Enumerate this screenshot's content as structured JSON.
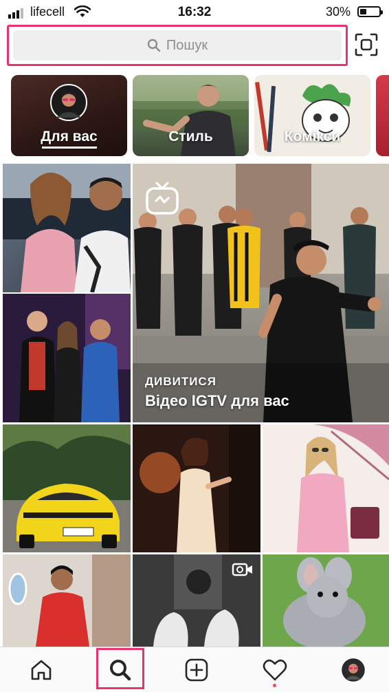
{
  "status_bar": {
    "carrier": "lifecell",
    "time": "16:32",
    "battery": "30%"
  },
  "search": {
    "placeholder": "Пошук"
  },
  "topics": [
    {
      "label": "Для вас",
      "selected": true
    },
    {
      "label": "Стиль",
      "selected": false
    },
    {
      "label": "Комікси",
      "selected": false
    }
  ],
  "igtv": {
    "subtitle": "ДИВИТИСЯ",
    "title": "Відео IGTV для вас"
  },
  "grid_posts": [
    {
      "name": "post-selfie-couple"
    },
    {
      "name": "post-event-trio"
    },
    {
      "name": "post-igtv-group"
    },
    {
      "name": "post-yellow-car"
    },
    {
      "name": "post-woman-doorway"
    },
    {
      "name": "post-woman-umbrella"
    },
    {
      "name": "post-man-jet"
    },
    {
      "name": "post-sneakers-video"
    },
    {
      "name": "post-chinchilla"
    }
  ],
  "tab_bar": {
    "items": [
      "home",
      "search",
      "new-post",
      "activity",
      "profile"
    ],
    "active": "search"
  },
  "colors": {
    "highlight": "#e8336d",
    "notification_dot": "#ed4956"
  }
}
